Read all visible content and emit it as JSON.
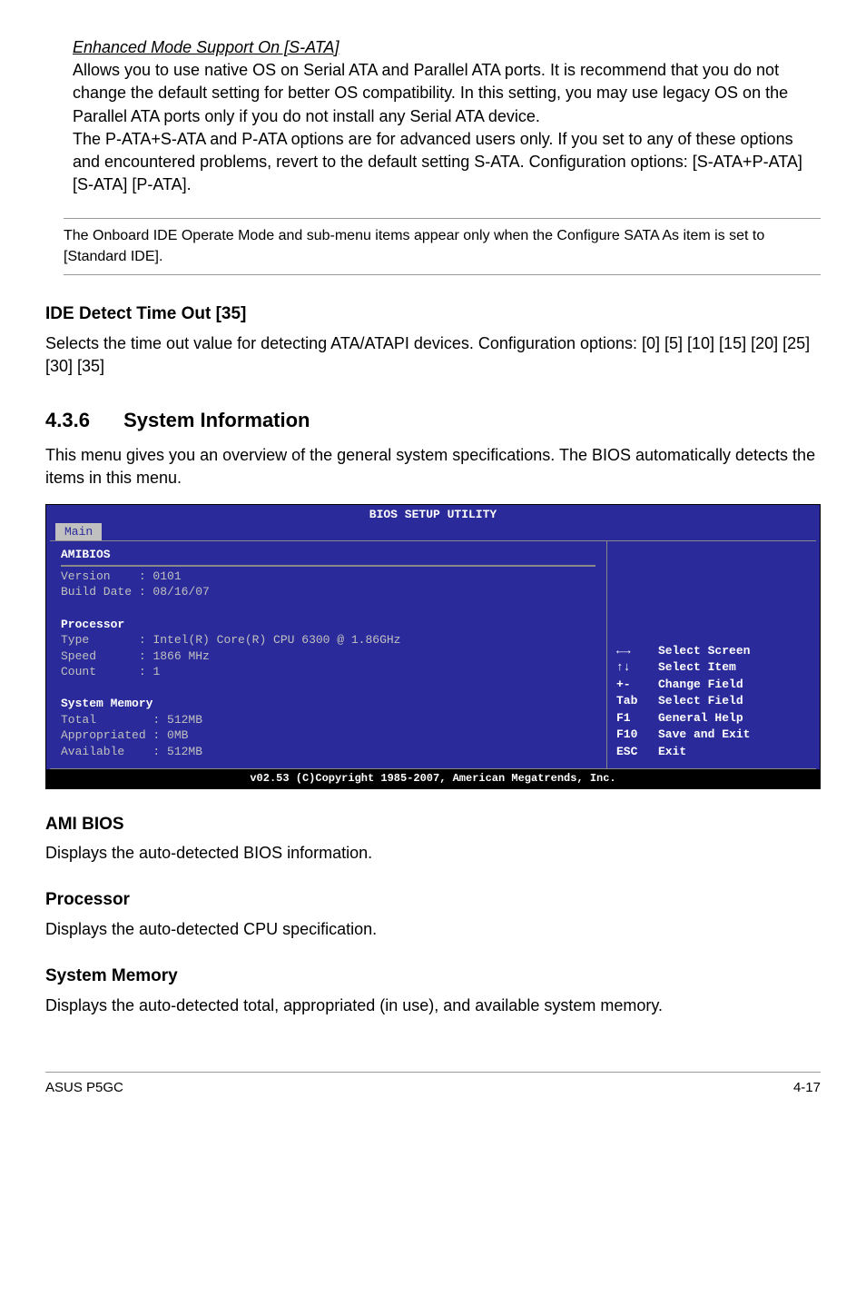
{
  "section_enhanced": {
    "title": "Enhanced Mode Support On [S-ATA]",
    "para1": "Allows you to use native OS on Serial ATA and Parallel ATA ports. It is recommend that you do not change the default setting for better OS compatibility. In this setting, you may use legacy OS on the Parallel ATA ports only if you do not install any Serial ATA device.",
    "para2": "The P-ATA+S-ATA and P-ATA options are for advanced users only. If you set to any of these options and encountered problems, revert to the default setting S-ATA. Configuration options: [S-ATA+P-ATA] [S-ATA] [P-ATA]."
  },
  "note": "The Onboard IDE Operate Mode and sub-menu items appear only when the Configure SATA As item is set to [Standard IDE].",
  "ide_detect": {
    "title": "IDE Detect Time Out [35]",
    "para": "Selects the time out value for detecting ATA/ATAPI devices. Configuration options: [0] [5] [10] [15] [20] [25] [30] [35]"
  },
  "sysinfo": {
    "num": "4.3.6",
    "title": "System Information",
    "para": "This menu gives you an overview of the general system specifications. The BIOS automatically detects the items in this menu."
  },
  "bios": {
    "title": "BIOS SETUP UTILITY",
    "tab": "Main",
    "amibios_label": "AMIBIOS",
    "version_label": "Version",
    "version_value": "0101",
    "builddate_label": "Build Date",
    "builddate_value": "08/16/07",
    "proc_label": "Processor",
    "type_label": "Type",
    "type_value": "Intel(R) Core(R) CPU 6300 @ 1.86GHz",
    "speed_label": "Speed",
    "speed_value": "1866 MHz",
    "count_label": "Count",
    "count_value": "1",
    "mem_label": "System Memory",
    "total_label": "Total",
    "total_value": "512MB",
    "appr_label": "Appropriated",
    "appr_value": "0MB",
    "avail_label": "Available",
    "avail_value": "512MB",
    "help": {
      "arrows_lr": "←→",
      "arrows_lr_v": "Select Screen",
      "arrows_ud": "↑↓",
      "arrows_ud_v": "Select Item",
      "pm": "+-",
      "pm_v": "Change Field",
      "tab": "Tab",
      "tab_v": "Select Field",
      "f1": "F1",
      "f1_v": "General Help",
      "f10": "F10",
      "f10_v": "Save and Exit",
      "esc": "ESC",
      "esc_v": "Exit"
    },
    "footer": "v02.53 (C)Copyright 1985-2007, American Megatrends, Inc."
  },
  "ami_bios": {
    "title": "AMI BIOS",
    "para": "Displays the auto-detected BIOS information."
  },
  "processor": {
    "title": "Processor",
    "para": "Displays the auto-detected CPU specification."
  },
  "sysmem": {
    "title": "System Memory",
    "para": "Displays the auto-detected total, appropriated (in use), and available system memory."
  },
  "footer": {
    "left": "ASUS P5GC",
    "right": "4-17"
  }
}
